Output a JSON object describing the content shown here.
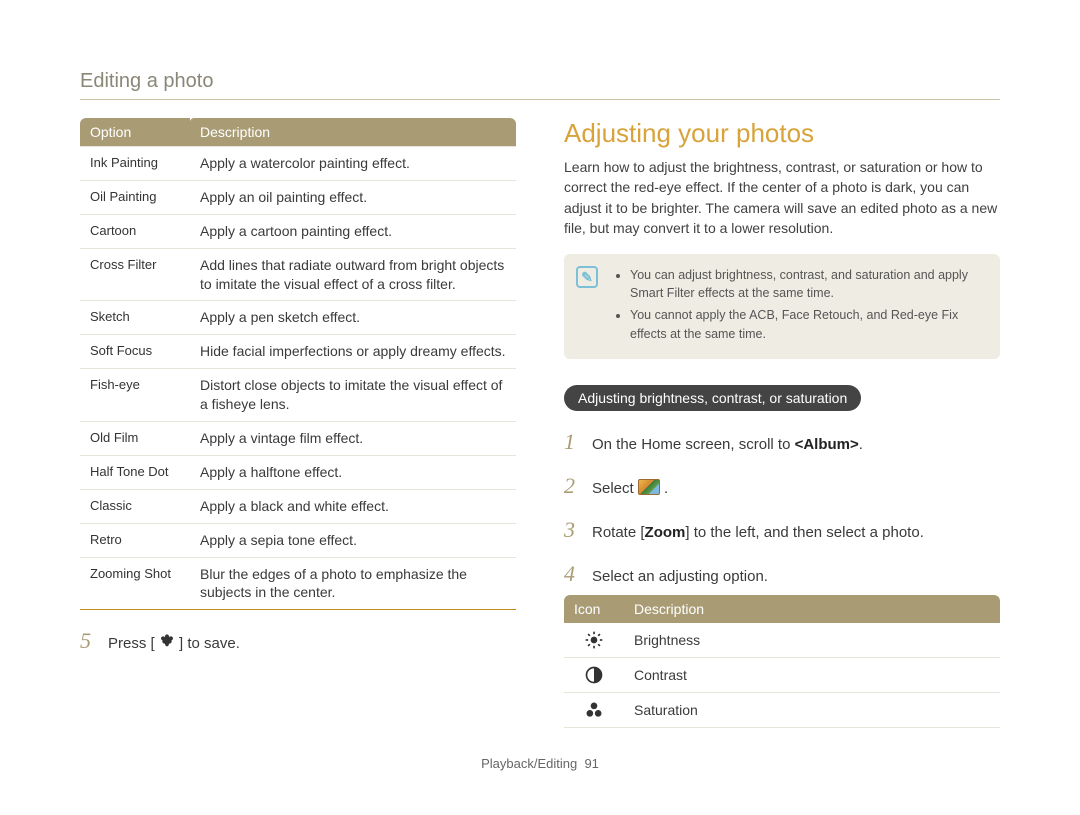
{
  "page_title": "Editing a photo",
  "left_table": {
    "head_option": "Option",
    "head_desc": "Description",
    "rows": [
      {
        "opt": "Ink Painting",
        "desc": "Apply a watercolor painting effect."
      },
      {
        "opt": "Oil Painting",
        "desc": "Apply an oil painting effect."
      },
      {
        "opt": "Cartoon",
        "desc": "Apply a cartoon painting effect."
      },
      {
        "opt": "Cross Filter",
        "desc": "Add lines that radiate outward from bright objects to imitate the visual effect of a cross filter."
      },
      {
        "opt": "Sketch",
        "desc": "Apply a pen sketch effect."
      },
      {
        "opt": "Soft Focus",
        "desc": "Hide facial imperfections or apply dreamy effects."
      },
      {
        "opt": "Fish-eye",
        "desc": "Distort close objects to imitate the visual effect of a fisheye lens."
      },
      {
        "opt": "Old Film",
        "desc": "Apply a vintage film effect."
      },
      {
        "opt": "Half Tone Dot",
        "desc": "Apply a halftone effect."
      },
      {
        "opt": "Classic",
        "desc": "Apply a black and white effect."
      },
      {
        "opt": "Retro",
        "desc": "Apply a sepia tone effect."
      },
      {
        "opt": "Zooming Shot",
        "desc": "Blur the edges of a photo to emphasize the subjects in the center."
      }
    ]
  },
  "left_step": {
    "num": "5",
    "prefix": "Press [",
    "suffix": "] to save."
  },
  "right": {
    "heading": "Adjusting your photos",
    "intro": "Learn how to adjust the brightness, contrast, or saturation or how to correct the red-eye effect. If the center of a photo is dark, you can adjust it to be brighter. The camera will save an edited photo as a new file, but may convert it to a lower resolution.",
    "notes": [
      "You can adjust brightness, contrast, and saturation and apply Smart Filter effects at the same time.",
      "You cannot apply the ACB, Face Retouch, and Red-eye Fix effects at the same time."
    ],
    "subheading": "Adjusting brightness, contrast, or saturation",
    "steps": {
      "s1_num": "1",
      "s1_pre": "On the Home screen, scroll to ",
      "s1_bold": "<Album>",
      "s1_post": ".",
      "s2_num": "2",
      "s2_pre": "Select ",
      "s2_post": ".",
      "s3_num": "3",
      "s3_pre": "Rotate [",
      "s3_bold": "Zoom",
      "s3_post": "] to the left, and then select a photo.",
      "s4_num": "4",
      "s4_txt": "Select an adjusting option."
    },
    "icon_table": {
      "head_icon": "Icon",
      "head_desc": "Description",
      "rows": [
        {
          "name": "brightness-icon",
          "desc": "Brightness"
        },
        {
          "name": "contrast-icon",
          "desc": "Contrast"
        },
        {
          "name": "saturation-icon",
          "desc": "Saturation"
        }
      ]
    }
  },
  "footer": {
    "section": "Playback/Editing",
    "page": "91"
  }
}
